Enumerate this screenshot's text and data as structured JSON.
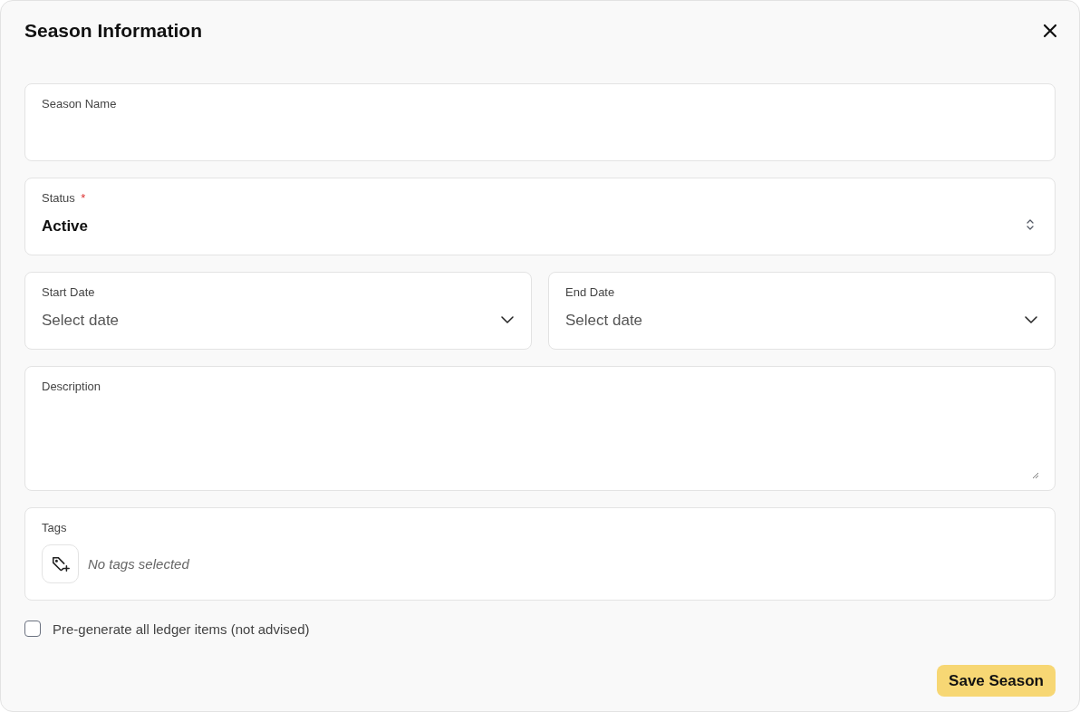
{
  "dialog": {
    "title": "Season Information"
  },
  "fields": [
    {
      "kind": "text",
      "label": "Season Name"
    },
    {
      "kind": "select",
      "label": "Status",
      "required_mark": "*",
      "value": "Active"
    },
    {
      "kind": "dates",
      "items": [
        {
          "label": "Start Date",
          "placeholder": "Select date"
        },
        {
          "label": "End Date",
          "placeholder": "Select date"
        }
      ]
    },
    {
      "kind": "textarea",
      "label": "Description"
    },
    {
      "kind": "tags",
      "label": "Tags",
      "empty_text": "No tags selected"
    }
  ],
  "checkbox": {
    "label": "Pre-generate all ledger items (not advised)",
    "checked": false
  },
  "buttons": [
    {
      "label": "Save Season"
    }
  ]
}
